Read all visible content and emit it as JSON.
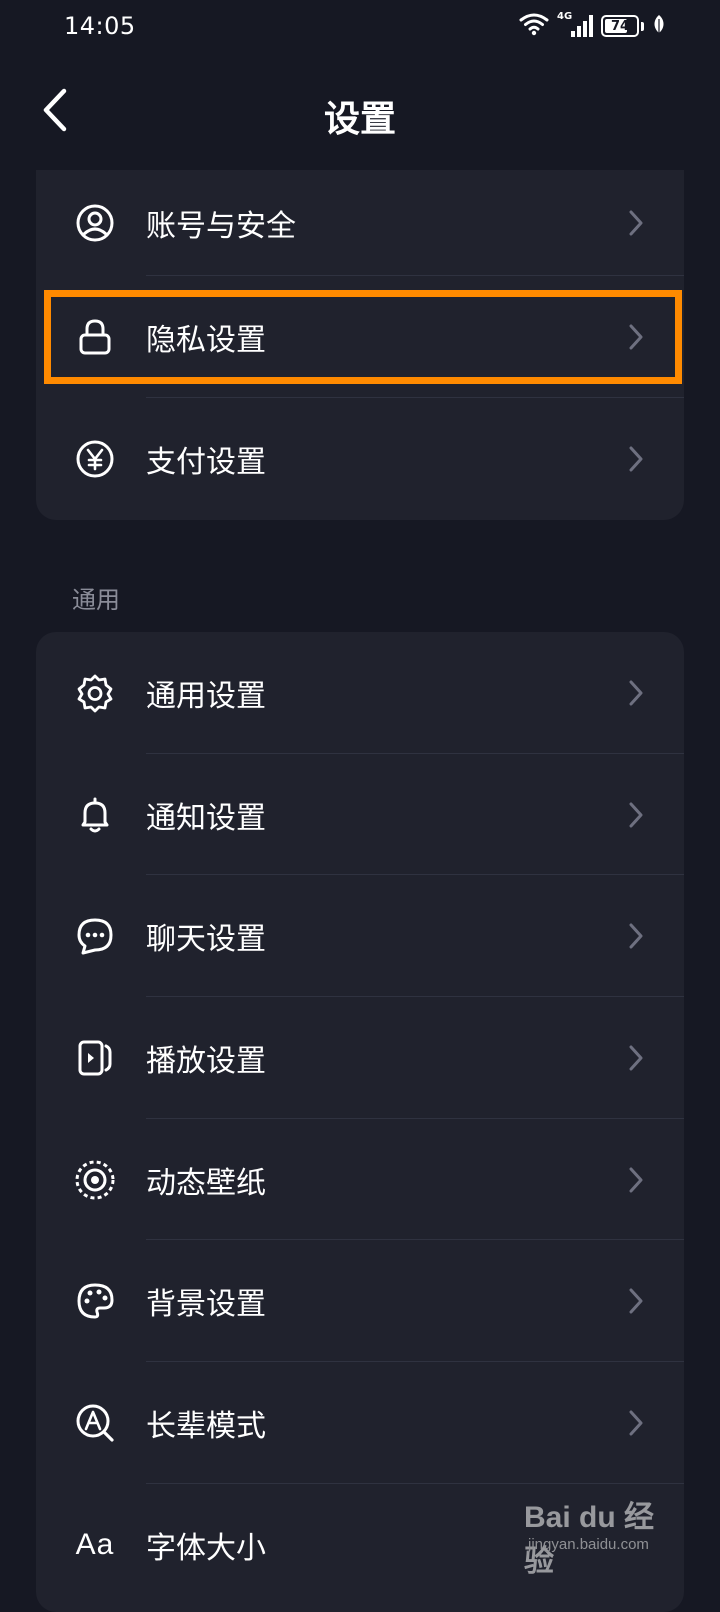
{
  "status_bar": {
    "time": "14:05",
    "network": "4G",
    "battery_level": "74",
    "battery_fraction": 0.74,
    "icons": [
      "wifi-icon",
      "signal-icon",
      "battery-icon",
      "leaf-icon"
    ]
  },
  "nav": {
    "title": "设置",
    "back_icon": "back-chevron-icon"
  },
  "account_section": {
    "items": [
      {
        "label": "账号与安全",
        "icon": "user-circle-icon"
      },
      {
        "label": "隐私设置",
        "icon": "lock-icon",
        "highlighted": true
      },
      {
        "label": "支付设置",
        "icon": "yen-circle-icon"
      }
    ]
  },
  "general_section": {
    "header": "通用",
    "items": [
      {
        "label": "通用设置",
        "icon": "gear-icon"
      },
      {
        "label": "通知设置",
        "icon": "bell-icon"
      },
      {
        "label": "聊天设置",
        "icon": "chat-bubble-icon"
      },
      {
        "label": "播放设置",
        "icon": "play-screen-icon"
      },
      {
        "label": "动态壁纸",
        "icon": "wallpaper-icon"
      },
      {
        "label": "背景设置",
        "icon": "palette-icon"
      },
      {
        "label": "长辈模式",
        "icon": "elder-mode-icon"
      },
      {
        "label": "字体大小",
        "icon": "font-size-icon",
        "glyph": "Aa"
      }
    ]
  },
  "colors": {
    "background": "#161823",
    "card": "#20222d",
    "divider": "#2f3240",
    "text": "#ffffff",
    "muted_text": "#8a8c98",
    "chevron": "#6e7080",
    "highlight": "#ff8a00"
  },
  "watermark": {
    "brand": "Bai du 经验",
    "url": "jingyan.baidu.com"
  }
}
